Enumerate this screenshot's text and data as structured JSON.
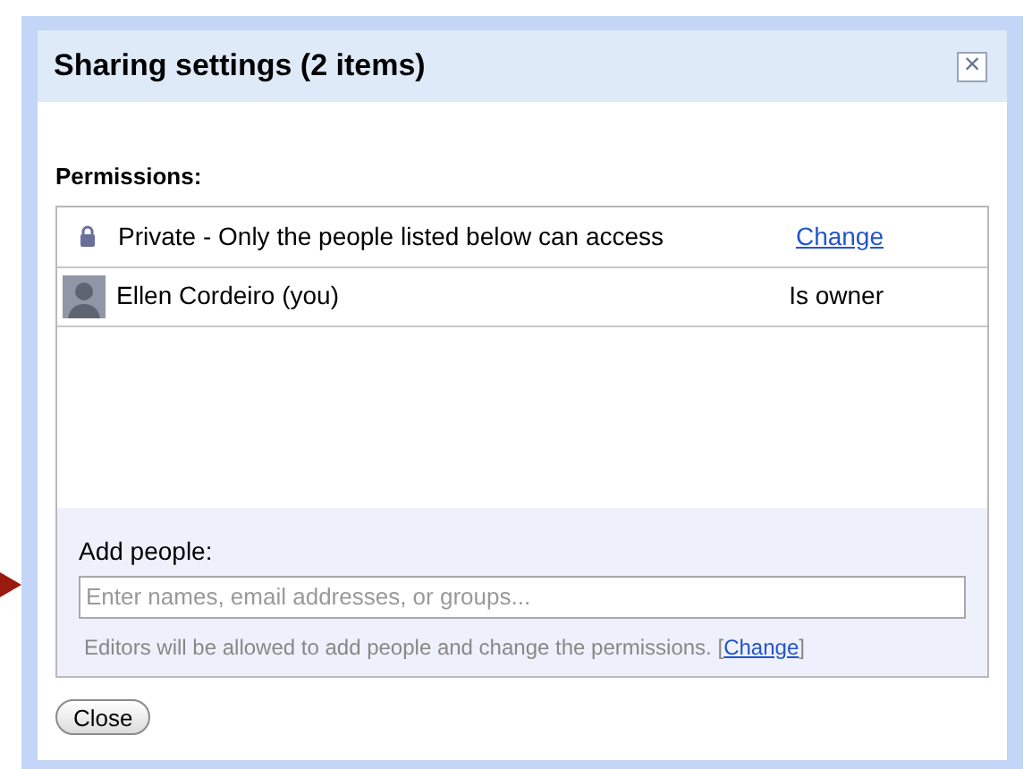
{
  "dialog": {
    "title": "Sharing settings (2 items)",
    "close_icon": "×"
  },
  "permissions": {
    "label": "Permissions:",
    "rows": [
      {
        "kind": "visibility",
        "text": "Private - Only the people listed below can access",
        "action": "Change"
      },
      {
        "kind": "person",
        "text": "Ellen Cordeiro (you)",
        "role": "Is owner"
      }
    ]
  },
  "add_people": {
    "label": "Add people:",
    "placeholder": "Enter names, email addresses, or groups...",
    "note": "Editors will be allowed to add people and change the permissions.",
    "note_open": "[",
    "note_link": "Change",
    "note_close": "]"
  },
  "buttons": [
    "Close"
  ]
}
